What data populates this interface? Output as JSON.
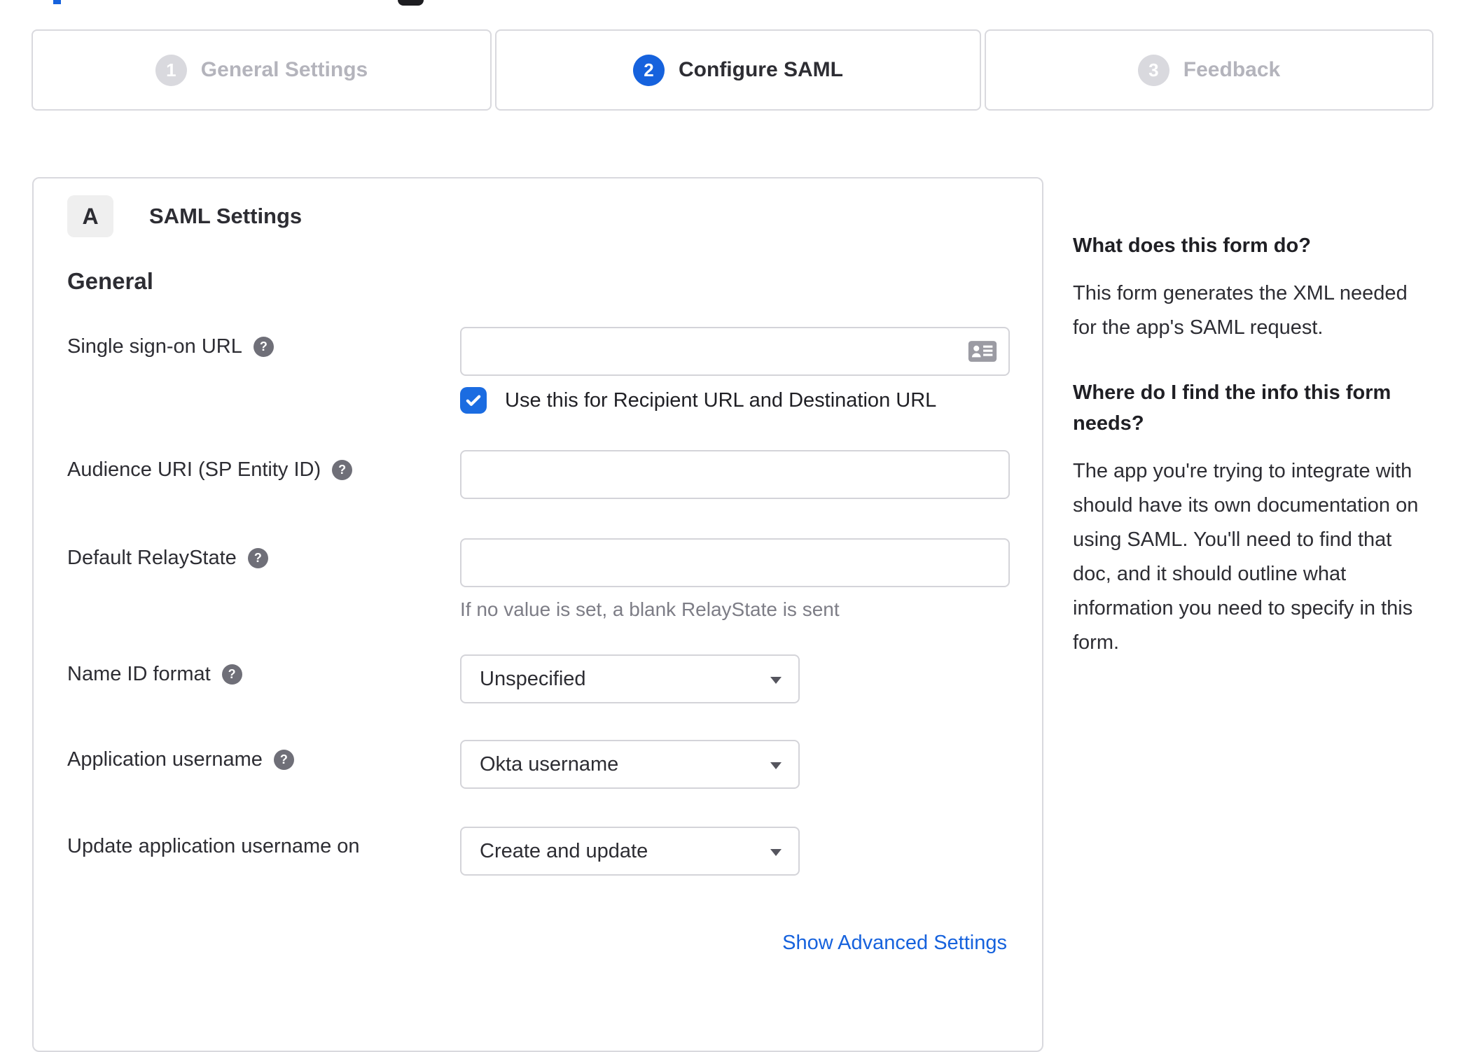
{
  "colors": {
    "accent_blue": "#1662dd",
    "checkbox_blue": "#1b6ce1",
    "border_gray": "#d9d9de",
    "text_dark": "#2d2d33",
    "inactive_label_gray": "#b4b4bc",
    "muted_gray": "#7d7d86",
    "icon_gray": "#9b9ba3",
    "help_icon_gray": "#6f6f78"
  },
  "icons": {
    "help_glyph": "?"
  },
  "stepper": {
    "steps": [
      {
        "number": "1",
        "label": "General Settings",
        "state": "inactive"
      },
      {
        "number": "2",
        "label": "Configure SAML",
        "state": "active"
      },
      {
        "number": "3",
        "label": "Feedback",
        "state": "inactive"
      }
    ]
  },
  "panel": {
    "badge": "A",
    "title": "SAML Settings",
    "section_heading": "General",
    "fields": [
      {
        "label": "Single sign-on URL",
        "type": "text",
        "value": "",
        "has_help": true,
        "checkbox_checked": true,
        "checkbox_label": "Use this for Recipient URL and Destination URL"
      },
      {
        "label": "Audience URI (SP Entity ID)",
        "type": "text",
        "value": "",
        "has_help": true
      },
      {
        "label": "Default RelayState",
        "type": "text",
        "value": "",
        "has_help": true,
        "helper_text": "If no value is set, a blank RelayState is sent"
      },
      {
        "label": "Name ID format",
        "type": "select",
        "value": "Unspecified",
        "has_help": true
      },
      {
        "label": "Application username",
        "type": "select",
        "value": "Okta username",
        "has_help": true
      },
      {
        "label": "Update application username on",
        "type": "select",
        "value": "Create and update",
        "has_help": false
      }
    ],
    "advanced_link": "Show Advanced Settings"
  },
  "sidebar": {
    "sections": [
      {
        "heading": "What does this form do?",
        "body": "This form generates the XML needed for the app's SAML request."
      },
      {
        "heading": "Where do I find the info this form needs?",
        "body": "The app you're trying to integrate with should have its own documentation on using SAML. You'll need to find that doc, and it should outline what information you need to specify in this form."
      }
    ]
  }
}
